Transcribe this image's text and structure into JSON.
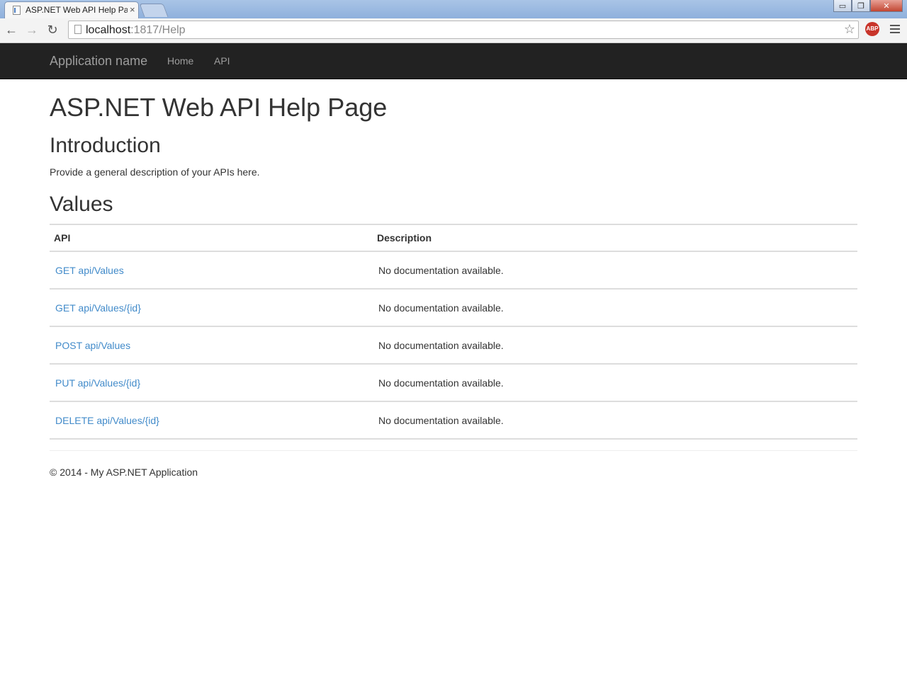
{
  "browser": {
    "tab_title": "ASP.NET Web API Help Pa",
    "tab_close": "×",
    "url_host": "localhost",
    "url_path": ":1817/Help",
    "extension_label": "ABP",
    "window_buttons": [
      "▭",
      "❐",
      "✕"
    ]
  },
  "navbar": {
    "brand": "Application name",
    "links": [
      "Home",
      "API"
    ]
  },
  "page": {
    "title": "ASP.NET Web API Help Page",
    "intro_heading": "Introduction",
    "intro_text": "Provide a general description of your APIs here.",
    "values_heading": "Values",
    "table": {
      "headers": [
        "API",
        "Description"
      ],
      "rows": [
        {
          "api": "GET api/Values",
          "description": "No documentation available."
        },
        {
          "api": "GET api/Values/{id}",
          "description": "No documentation available."
        },
        {
          "api": "POST api/Values",
          "description": "No documentation available."
        },
        {
          "api": "PUT api/Values/{id}",
          "description": "No documentation available."
        },
        {
          "api": "DELETE api/Values/{id}",
          "description": "No documentation available."
        }
      ]
    }
  },
  "footer": {
    "text": "© 2014 - My ASP.NET Application"
  },
  "colors": {
    "navbar_bg": "#222222",
    "navbar_text": "#9d9d9d",
    "link": "#428bca",
    "text": "#333333",
    "rule": "#dddddd"
  }
}
